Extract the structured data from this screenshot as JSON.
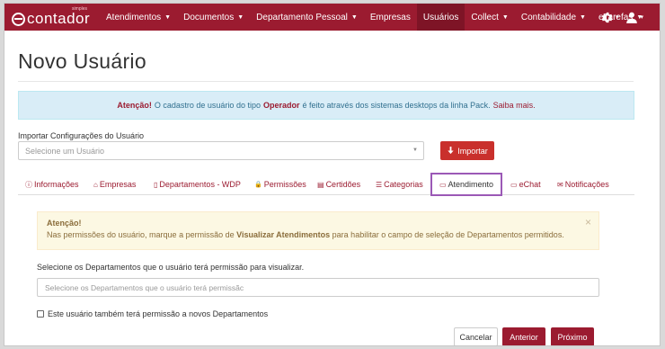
{
  "brand": {
    "logo_text": "contador",
    "logo_sub": "simples"
  },
  "nav": {
    "items": [
      {
        "label": "Atendimentos",
        "caret": "▼"
      },
      {
        "label": "Documentos",
        "caret": "▼"
      },
      {
        "label": "Departamento Pessoal",
        "caret": "▼"
      },
      {
        "label": "Empresas",
        "caret": ""
      },
      {
        "label": "Usuários",
        "caret": ""
      },
      {
        "label": "Collect",
        "caret": "▼"
      },
      {
        "label": "Contabilidade",
        "caret": "▼"
      },
      {
        "label": "eTarefas",
        "caret": "▼"
      }
    ],
    "active_index": 4,
    "right_icons": [
      "gear-icon",
      "user-icon"
    ]
  },
  "page": {
    "title": "Novo Usuário"
  },
  "info_alert": {
    "strong": "Atenção!",
    "text_1": "O cadastro de usuário do tipo",
    "operator": "Operador",
    "text_2": "é feito através dos sistemas desktops da linha Pack.",
    "link": "Saiba mais."
  },
  "import": {
    "label": "Importar Configurações do Usuário",
    "placeholder": "Selecione um Usuário",
    "button": "Importar",
    "button_icon": "download-icon"
  },
  "tabs": [
    {
      "label": "Informações",
      "icon": "ⓘ"
    },
    {
      "label": "Empresas",
      "icon": "⌂"
    },
    {
      "label": "Departamentos - WDP",
      "icon": "▯"
    },
    {
      "label": "Permissões",
      "icon": "🔒"
    },
    {
      "label": "Certidões",
      "icon": "▤"
    },
    {
      "label": "Categorias",
      "icon": "☰"
    },
    {
      "label": "Atendimento",
      "icon": "▭"
    },
    {
      "label": "eChat",
      "icon": "▭"
    },
    {
      "label": "Notificações",
      "icon": "✉"
    }
  ],
  "active_tab": 6,
  "warning": {
    "title": "Atenção!",
    "text_1": "Nas permissões do usuário, marque a permissão de",
    "bold": "Visualizar Atendimentos",
    "text_2": "para habilitar o campo de seleção de Departamentos permitidos.",
    "close": "×"
  },
  "departments": {
    "label": "Selecione os Departamentos que o usuário terá permissão para visualizar.",
    "placeholder": "Selecione os Departamentos que o usuário terá permissãc"
  },
  "checkbox": {
    "label": "Este usuário também terá permissão a novos Departamentos",
    "checked": false
  },
  "buttons": {
    "cancel": "Cancelar",
    "previous": "Anterior",
    "next": "Próximo"
  },
  "colors": {
    "brand": "#9b1b30",
    "tab_highlight": "#9b59b6",
    "info_bg": "#d9edf7",
    "warn_bg": "#fcf8e3"
  }
}
